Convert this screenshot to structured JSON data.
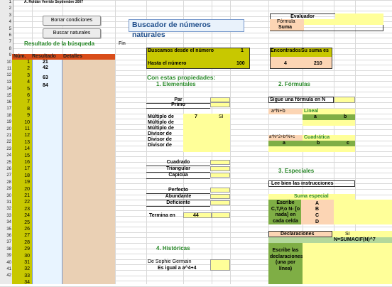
{
  "header": {
    "author": "A. Roldán Verrido Septiembre 2007",
    "title": "Buscador de números naturales",
    "fin": "Fin"
  },
  "buttons": {
    "borrar": "Borrar condiciones",
    "buscar": "Buscar naturales"
  },
  "results": {
    "title": "Resultado de la búsqueda",
    "col_num": "Núm.",
    "col_res": "Resultado",
    "col_det": "Detalles",
    "values": [
      "21",
      "42",
      "63",
      "84"
    ]
  },
  "row_numbers": [
    "1",
    "2",
    "3",
    "4",
    "5",
    "6",
    "7",
    "8",
    "9",
    "10",
    "11",
    "12",
    "13",
    "14",
    "15",
    "16",
    "17",
    "18",
    "19",
    "20",
    "21",
    "22",
    "23",
    "24",
    "25",
    "26",
    "27",
    "28",
    "29",
    "30",
    "31",
    "32",
    "33",
    "34",
    "35",
    "36",
    "37",
    "38",
    "39",
    "40",
    "41",
    "42"
  ],
  "index_numbers": [
    "1",
    "2",
    "3",
    "4",
    "5",
    "6",
    "7",
    "8",
    "9",
    "10",
    "11",
    "12",
    "13",
    "14",
    "15",
    "16",
    "17",
    "18",
    "19",
    "20",
    "21",
    "22",
    "23",
    "24",
    "25",
    "26",
    "27",
    "28",
    "29",
    "30",
    "31",
    "32",
    "33",
    "34"
  ],
  "range": {
    "desde_label": "Buscamos desde el número",
    "desde_val": "1",
    "hasta_label": "Hasta el número",
    "hasta_val": "100"
  },
  "props": {
    "title": "Con estas propiedades:",
    "s1": "1. Elementales",
    "par": "Par",
    "primo": "Primo",
    "multiplo": "Múltiplo de",
    "multiplo_val": "7",
    "multiplo_si": "SI",
    "divisor": "Divisor de",
    "cuadrado": "Cuadrado",
    "triangular": "Triangular",
    "capicua": "Capicúa",
    "perfecto": "Perfecto",
    "abundante": "Abundante",
    "deficiente": "Deficiente",
    "termina": "Termina en",
    "termina_val": "44"
  },
  "hist": {
    "title": "4. Históricas",
    "sophie": "De Sophie Germain",
    "es_igual": "Es igual a a^4+4"
  },
  "evaluador": {
    "title": "Evaluador",
    "formula": "Fórmula",
    "suma": "Suma"
  },
  "found": {
    "encontrados": "Encontrados",
    "suma": "Su suma es",
    "encontrados_val": "4",
    "suma_val": "210"
  },
  "formulas": {
    "title": "2. Fórmulas",
    "sigue": "Sigue una fórmula en N",
    "an_b": "a*N+b",
    "lineal": "Lineal",
    "a": "a",
    "b": "b",
    "c": "c",
    "cuad_f": "a*N^2+b*N+c",
    "cuadratica": "Cuadrática"
  },
  "especiales": {
    "title": "3. Especiales",
    "lee": "Lee bien las instrucciones",
    "suma_especial": "Suma especial",
    "escribe": "Escribe C,T,P,o N- [o nada] en cada celda",
    "A": "A",
    "B": "B",
    "C": "C",
    "D": "D"
  },
  "declar": {
    "title": "Declaraciones",
    "si": "SI",
    "formula": "N=SUMACIF(N)^7",
    "escribe": "Escribe las declaraciones (una por línea)"
  }
}
